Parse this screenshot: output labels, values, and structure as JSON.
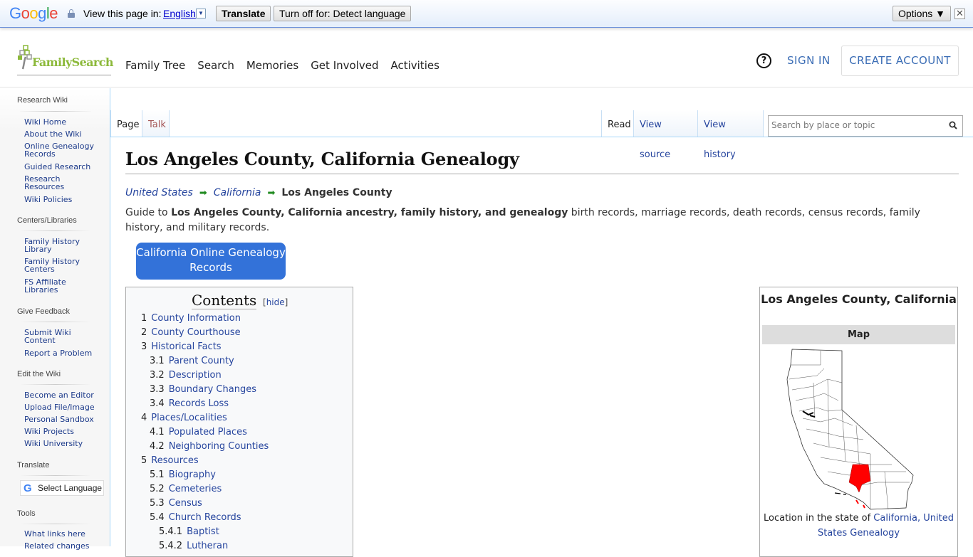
{
  "translate_bar": {
    "brand": "Google",
    "view_label": "View this page in:",
    "language": "English",
    "translate_button": "Translate",
    "turn_off_button": "Turn off for: Detect language",
    "options_button": "Options ▼",
    "close_glyph": "✕"
  },
  "header": {
    "logo_text": "FamilySearch",
    "nav": [
      "Family Tree",
      "Search",
      "Memories",
      "Get Involved",
      "Activities"
    ],
    "help_glyph": "?",
    "sign_in": "SIGN IN",
    "create_account": "CREATE ACCOUNT"
  },
  "sidebar": {
    "sections": [
      {
        "title": "Research Wiki",
        "items": [
          "Wiki Home",
          "About the Wiki",
          "Online Genealogy Records",
          "Guided Research",
          "Research Resources",
          "Wiki Policies"
        ]
      },
      {
        "title": "Centers/Libraries",
        "items": [
          "Family History Library",
          "Family History Centers",
          "FS Affiliate Libraries"
        ]
      },
      {
        "title": "Give Feedback",
        "items": [
          "Submit Wiki Content",
          "Report a Problem"
        ]
      },
      {
        "title": "Edit the Wiki",
        "items": [
          "Become an Editor",
          "Upload File/Image",
          "Personal Sandbox",
          "Wiki Projects",
          "Wiki University"
        ]
      },
      {
        "title": "Translate",
        "widget": "Select Language"
      },
      {
        "title": "Tools",
        "items": [
          "What links here",
          "Related changes"
        ]
      }
    ]
  },
  "tabs": {
    "left": [
      "Page",
      "Talk"
    ],
    "right": [
      "Read",
      "View source",
      "View history"
    ],
    "selected_left": "Page",
    "selected_right": "Read"
  },
  "search": {
    "placeholder": "Search by place or topic"
  },
  "page": {
    "title": "Los Angeles County, California Genealogy",
    "breadcrumb": [
      "United States",
      "California",
      "Los Angeles County"
    ],
    "intro_prefix": "Guide to ",
    "intro_bold": "Los Angeles County, California ancestry, family history, and genealogy",
    "intro_suffix": " birth records, marriage records, death records, census records, family history, and military records.",
    "cta_button": "California Online Genealogy Records"
  },
  "toc": {
    "title": "Contents",
    "hide_label": "hide",
    "entries": [
      {
        "num": "1",
        "label": "County Information",
        "level": 1
      },
      {
        "num": "2",
        "label": "County Courthouse",
        "level": 1
      },
      {
        "num": "3",
        "label": "Historical Facts",
        "level": 1
      },
      {
        "num": "3.1",
        "label": "Parent County",
        "level": 2
      },
      {
        "num": "3.2",
        "label": "Description",
        "level": 2
      },
      {
        "num": "3.3",
        "label": "Boundary Changes",
        "level": 2
      },
      {
        "num": "3.4",
        "label": "Records Loss",
        "level": 2
      },
      {
        "num": "4",
        "label": "Places/Localities",
        "level": 1
      },
      {
        "num": "4.1",
        "label": "Populated Places",
        "level": 2
      },
      {
        "num": "4.2",
        "label": "Neighboring Counties",
        "level": 2
      },
      {
        "num": "5",
        "label": "Resources",
        "level": 1
      },
      {
        "num": "5.1",
        "label": "Biography",
        "level": 2
      },
      {
        "num": "5.2",
        "label": "Cemeteries",
        "level": 2
      },
      {
        "num": "5.3",
        "label": "Census",
        "level": 2
      },
      {
        "num": "5.4",
        "label": "Church Records",
        "level": 2
      },
      {
        "num": "5.4.1",
        "label": "Baptist",
        "level": 3
      },
      {
        "num": "5.4.2",
        "label": "Lutheran",
        "level": 3
      }
    ]
  },
  "infobox": {
    "title": "Los Angeles County, California",
    "map_header": "Map",
    "caption_prefix": "Location in the state of ",
    "caption_link": "California, United States Genealogy",
    "highlight_color": "#ff0000"
  }
}
